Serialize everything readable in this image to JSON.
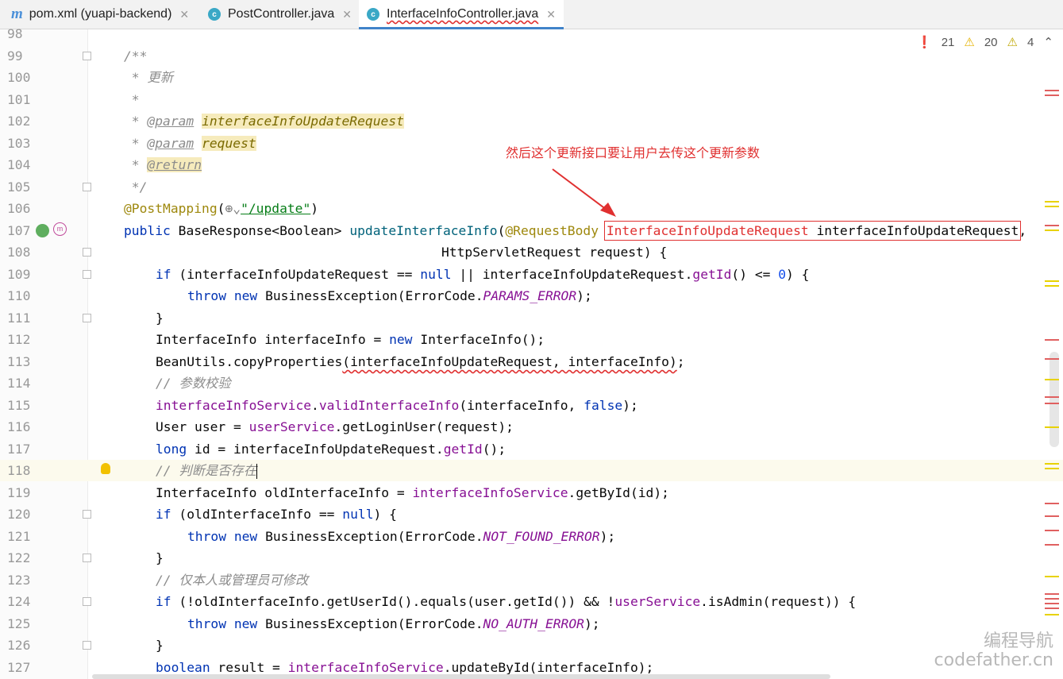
{
  "tabs": [
    {
      "label": "pom.xml (yuapi-backend)",
      "icon": "maven-icon",
      "active": false
    },
    {
      "label": "PostController.java",
      "icon": "java-class-icon",
      "active": false
    },
    {
      "label": "InterfaceInfoController.java",
      "icon": "java-class-icon",
      "active": true
    }
  ],
  "inspector": {
    "errors": "21",
    "warnings": "20",
    "weak_warnings": "4"
  },
  "annotation_text": "然后这个更新接口要让用户去传这个更新参数",
  "watermark": {
    "line1": "编程导航",
    "line2": "codefather.cn"
  },
  "lines": [
    {
      "n": "98"
    },
    {
      "n": "99"
    },
    {
      "n": "100"
    },
    {
      "n": "101"
    },
    {
      "n": "102"
    },
    {
      "n": "103"
    },
    {
      "n": "104"
    },
    {
      "n": "105"
    },
    {
      "n": "106"
    },
    {
      "n": "107"
    },
    {
      "n": "108"
    },
    {
      "n": "109"
    },
    {
      "n": "110"
    },
    {
      "n": "111"
    },
    {
      "n": "112"
    },
    {
      "n": "113"
    },
    {
      "n": "114"
    },
    {
      "n": "115"
    },
    {
      "n": "116"
    },
    {
      "n": "117"
    },
    {
      "n": "118"
    },
    {
      "n": "119"
    },
    {
      "n": "120"
    },
    {
      "n": "121"
    },
    {
      "n": "122"
    },
    {
      "n": "123"
    },
    {
      "n": "124"
    },
    {
      "n": "125"
    },
    {
      "n": "126"
    },
    {
      "n": "127"
    }
  ],
  "code": {
    "l99": "/**",
    "l100": " * 更新",
    "l101": " *",
    "l102_tag": "@param",
    "l102_name": "interfaceInfoUpdateRequest",
    "l103_tag": "@param",
    "l103_name": "request",
    "l104_tag": "@return",
    "l105": " */",
    "l106_ann": "@PostMapping",
    "l106_url": "\"/update\"",
    "l107_pre": "public",
    "l107_a": "BaseResponse<Boolean>",
    "l107_m": "updateInterfaceInfo",
    "l107_rb": "@RequestBody",
    "l107_type": "InterfaceInfoUpdateRequest",
    "l107_var": "interfaceInfoUpdateRequest",
    "l108": "HttpServletRequest request) {",
    "l109_a": "(interfaceInfoUpdateRequest == ",
    "l109_null": "null",
    "l109_b": " || interfaceInfoUpdateRequest.",
    "l109_m": "getId",
    "l109_c": "() <= ",
    "l109_0": "0",
    "l109_d": ") {",
    "l110_const": "PARAMS_ERROR",
    "l112": "InterfaceInfo interfaceInfo = ",
    "l112_b": "InterfaceInfo();",
    "l113_a": "BeanUtils.copyProperties",
    "l113_b": "(interfaceInfoUpdateRequest, interfaceInfo)",
    "l113_c": ";",
    "l114": "// 参数校验",
    "l115_f": "interfaceInfoService",
    "l115_m": "validInterfaceInfo",
    "l115_a": "(interfaceInfo, ",
    "l115_false": "false",
    "l115_b": ");",
    "l116_a": "User user ",
    "l116_b": "= ",
    "l116_f": "userService",
    "l116_c": ".getLoginUser(request)",
    "l116_d": ";",
    "l117_a": " id = interfaceInfoUpdateRequest.",
    "l117_m": "getId",
    "l117_b": "();",
    "l118": "// 判断是否存在",
    "l119_a": "InterfaceInfo oldInterfaceInfo = ",
    "l119_f": "interfaceInfoService",
    "l119_b": ".getById(id);",
    "l120_a": "(oldInterfaceInfo == ",
    "l120_null": "null",
    "l120_b": ") {",
    "l121_const": "NOT_FOUND_ERROR",
    "l123": "// 仅本人或管理员可修改",
    "l124_a": "(!oldInterfaceInfo.getUserId().equals(user.getId()) && !",
    "l124_f": "userService",
    "l124_b": ".isAdmin(request)) {",
    "l125_const": "NO_AUTH_ERROR",
    "l127_a": " result = ",
    "l127_f": "interfaceInfoService",
    "l127_b": ".updateById(interfaceInfo);",
    "kw_if": "if",
    "kw_throw": "throw",
    "kw_new": "new",
    "kw_long": "long",
    "kw_boolean": "boolean",
    "be": "BusinessException(ErrorCode.",
    "close": ");",
    "brace": "}"
  }
}
